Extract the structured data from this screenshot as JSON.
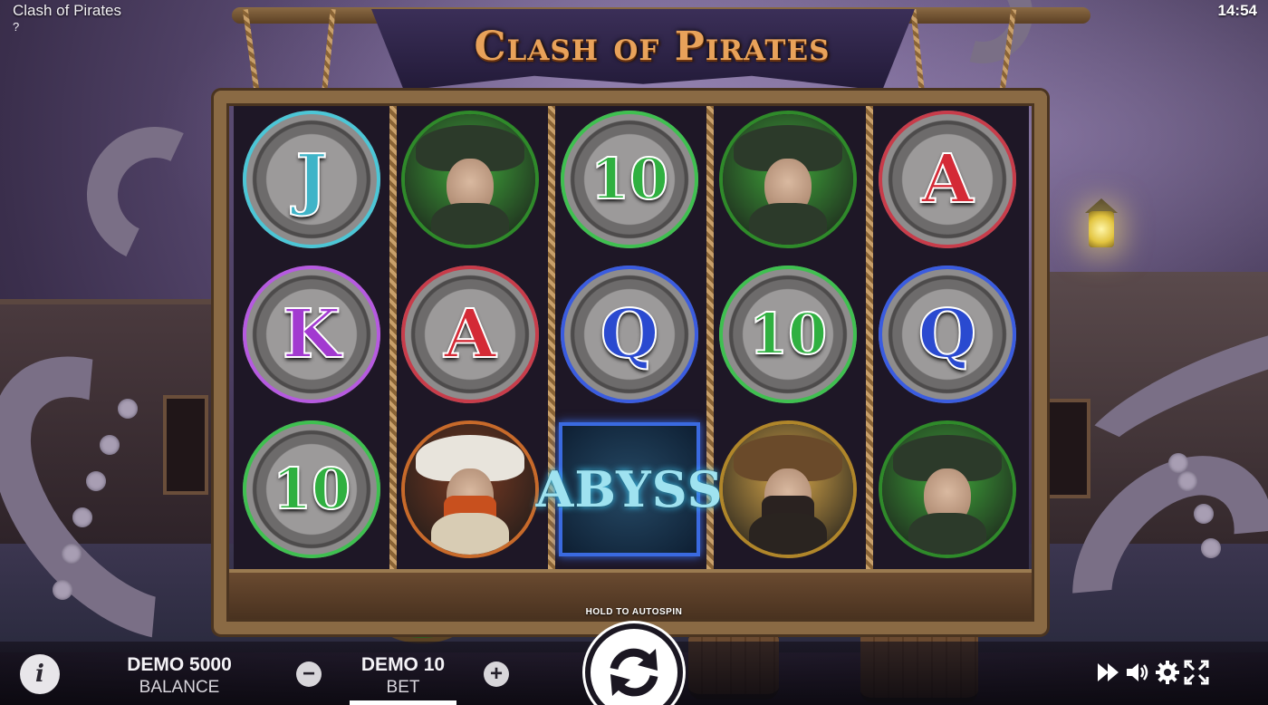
{
  "window": {
    "title": "Clash of Pirates",
    "help_mark": "?",
    "clock": "14:54"
  },
  "game": {
    "title": "Clash of Pirates"
  },
  "reels": [
    [
      {
        "type": "letter",
        "label": "J",
        "color": "#3fb4c8",
        "ring": "#4cc6d6"
      },
      {
        "type": "letter",
        "label": "K",
        "color": "#a23ad0",
        "ring": "#b65ae0"
      },
      {
        "type": "letter",
        "label": "10",
        "color": "#2fb040",
        "ring": "#3fc050"
      }
    ],
    [
      {
        "type": "portrait",
        "name": "green-captain",
        "bg": "#3fa83a",
        "ring": "#2f8a2a"
      },
      {
        "type": "letter",
        "label": "A",
        "color": "#d42a36",
        "ring": "#c83c4a"
      },
      {
        "type": "portrait",
        "name": "red-beard-pirate",
        "bg": "#7a3a22",
        "ring": "#c86a2a"
      }
    ],
    [
      {
        "type": "letter",
        "label": "10",
        "color": "#2fb040",
        "ring": "#3fc050"
      },
      {
        "type": "letter",
        "label": "Q",
        "color": "#2a4ad0",
        "ring": "#3a5ce0"
      },
      {
        "type": "scatter",
        "label": "ABYSS"
      }
    ],
    [
      {
        "type": "portrait",
        "name": "green-captain",
        "bg": "#3fa83a",
        "ring": "#2f8a2a"
      },
      {
        "type": "letter",
        "label": "10",
        "color": "#2fb040",
        "ring": "#3fc050"
      },
      {
        "type": "portrait",
        "name": "black-beard-captain",
        "bg": "#d8a84a",
        "ring": "#b0862a"
      }
    ],
    [
      {
        "type": "letter",
        "label": "A",
        "color": "#d42a36",
        "ring": "#c83c4a"
      },
      {
        "type": "letter",
        "label": "Q",
        "color": "#2a4ad0",
        "ring": "#3a5ce0"
      },
      {
        "type": "portrait",
        "name": "green-captain",
        "bg": "#3fa83a",
        "ring": "#2f8a2a"
      }
    ]
  ],
  "controls": {
    "info_label": "i",
    "balance_value": "DEMO 5000",
    "balance_caption": "BALANCE",
    "decrease_label": "−",
    "bet_value": "DEMO 10",
    "bet_caption": "BET",
    "increase_label": "+",
    "autospin_hint": "HOLD TO AUTOSPIN",
    "icons": [
      "fast-forward-icon",
      "volume-icon",
      "settings-gear-icon",
      "fullscreen-icon"
    ]
  }
}
